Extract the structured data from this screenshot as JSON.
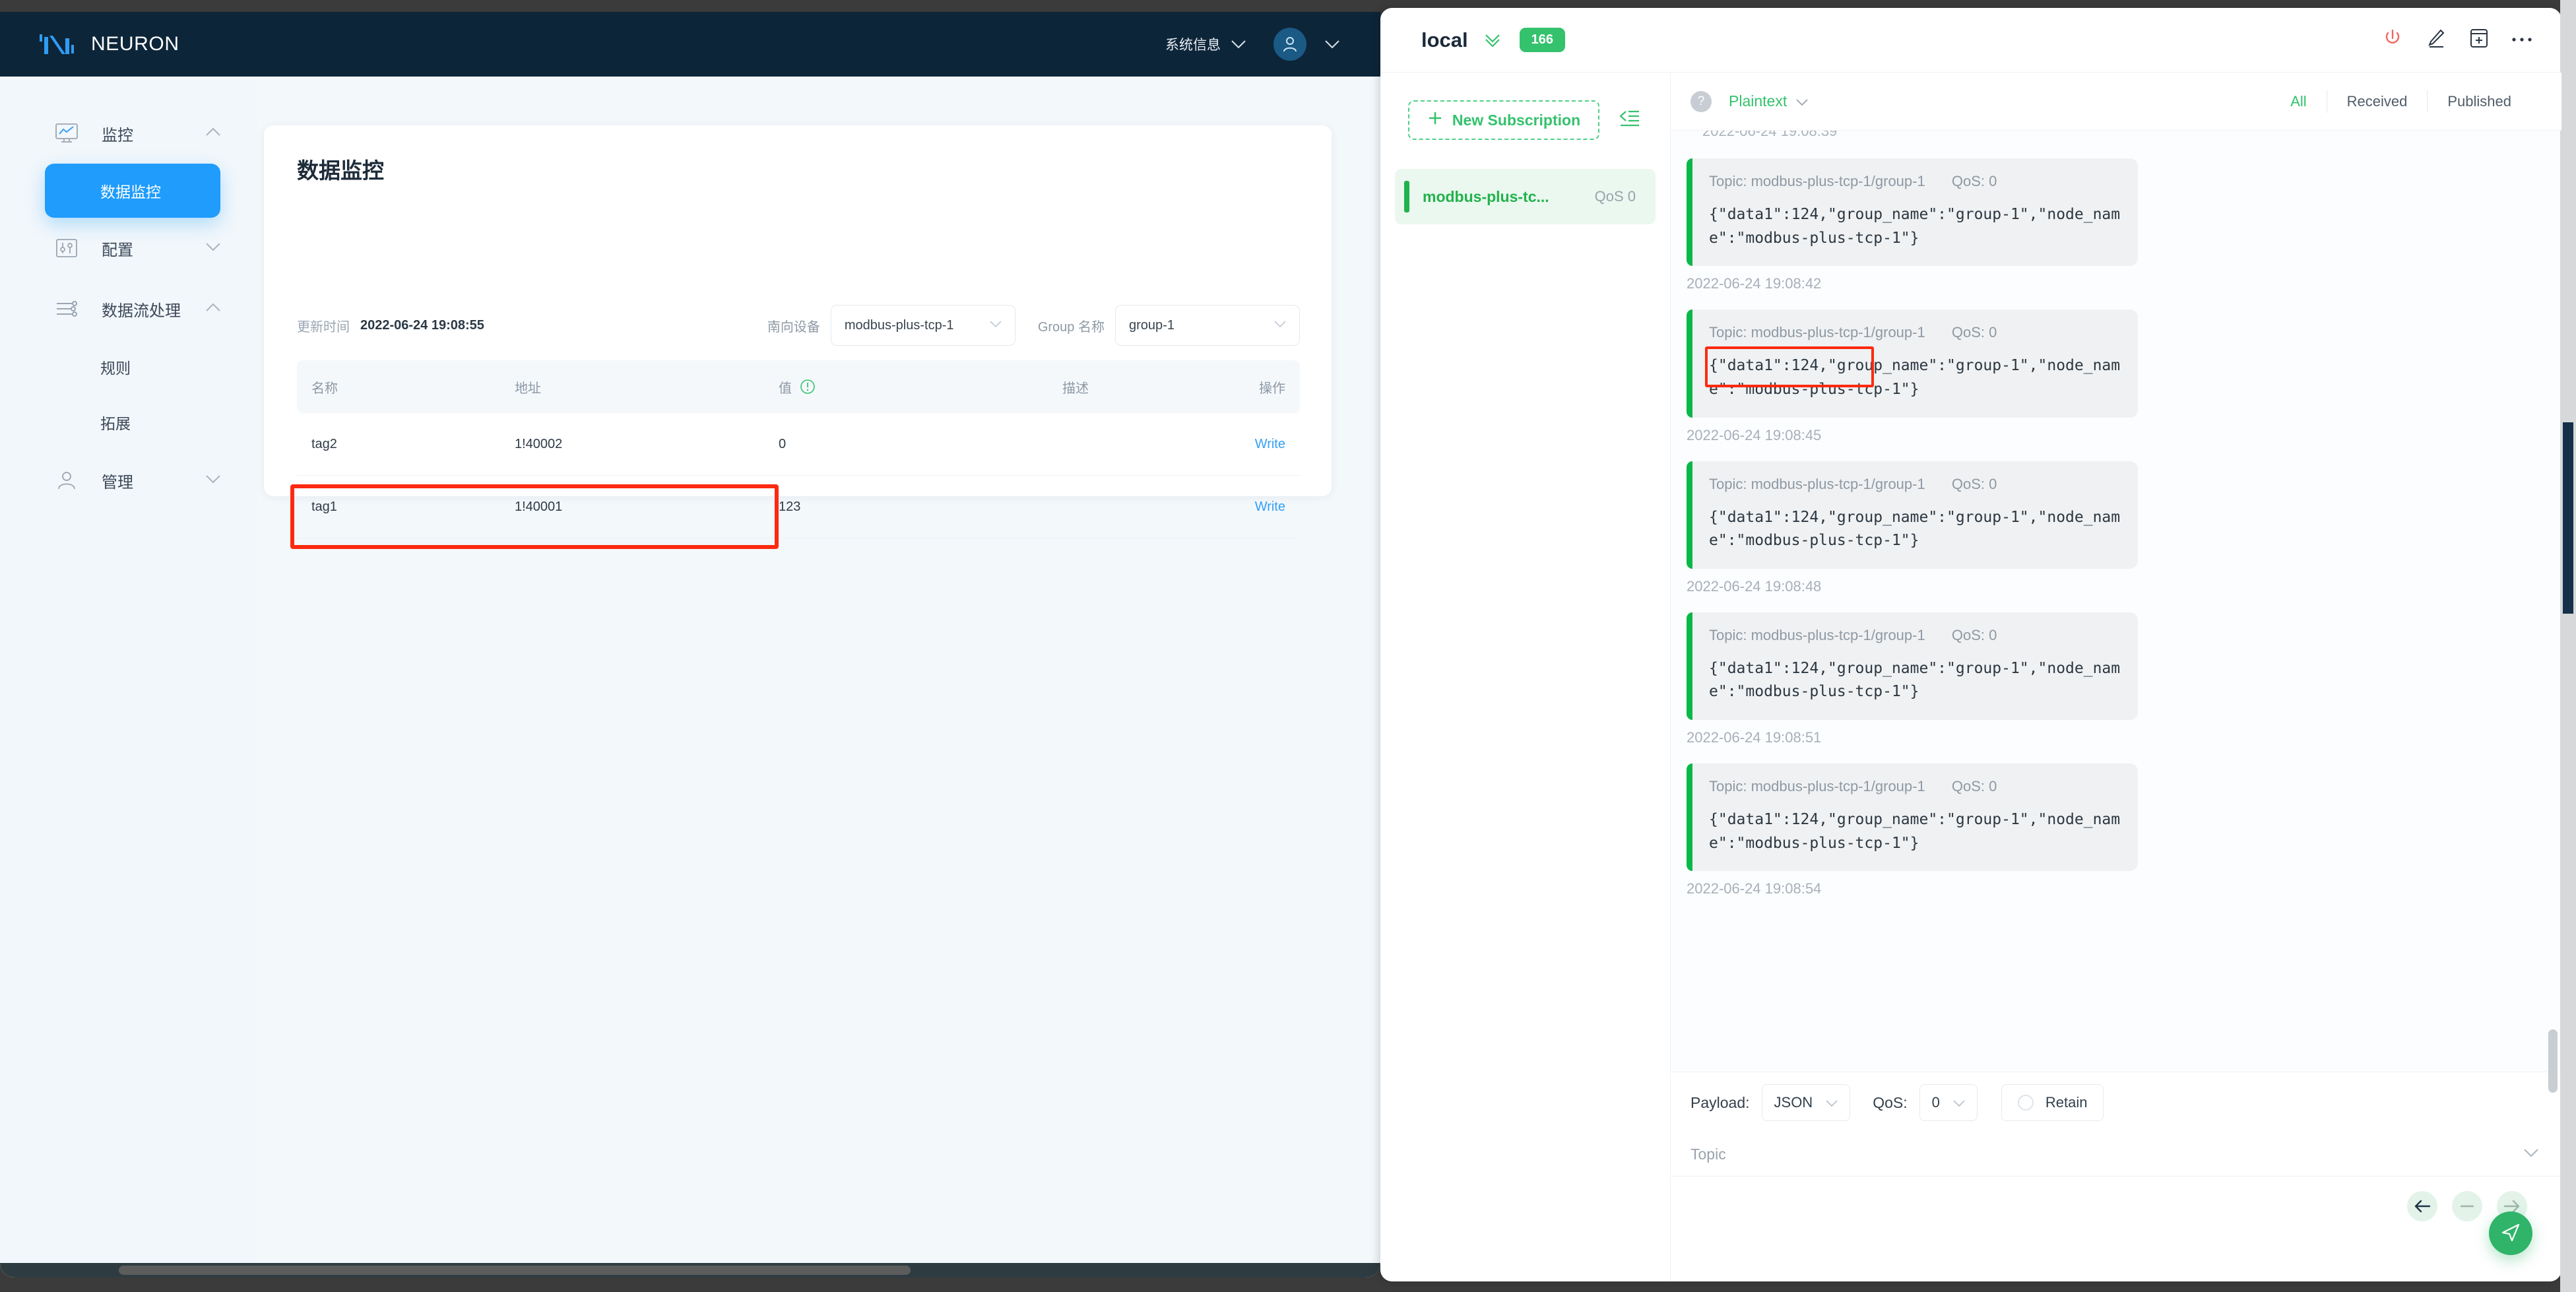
{
  "neuron": {
    "brand": "NEURON",
    "nav": {
      "system_info": "系统信息"
    },
    "sidebar": [
      {
        "label": "监控",
        "icon": "monitor-icon",
        "caret": "chevron-up-icon",
        "type": "group"
      },
      {
        "label": "数据监控",
        "type": "sub",
        "active": true
      },
      {
        "label": "配置",
        "icon": "sliders-icon",
        "caret": "chevron-down-icon",
        "type": "group"
      },
      {
        "label": "数据流处理",
        "icon": "dataflow-icon",
        "caret": "chevron-up-icon",
        "type": "group"
      },
      {
        "label": "规则",
        "type": "sub",
        "active": false
      },
      {
        "label": "拓展",
        "type": "sub",
        "active": false
      },
      {
        "label": "管理",
        "icon": "user-icon",
        "caret": "chevron-down-icon",
        "type": "group"
      }
    ],
    "page": {
      "title": "数据监控",
      "updated_label": "更新时间",
      "updated_value": "2022-06-24 19:08:55",
      "device_label": "南向设备",
      "device_value": "modbus-plus-tcp-1",
      "group_label": "Group 名称",
      "group_value": "group-1"
    },
    "table": {
      "headers": {
        "name": "名称",
        "address": "地址",
        "value": "值",
        "description": "描述",
        "operation": "操作"
      },
      "rows": [
        {
          "name": "tag2",
          "address": "1!40002",
          "value": "0",
          "description": "",
          "action": "Write",
          "highlighted": false
        },
        {
          "name": "tag1",
          "address": "1!40001",
          "value": "123",
          "description": "",
          "action": "Write",
          "highlighted": true
        }
      ]
    }
  },
  "mqttx": {
    "header": {
      "connection_name": "local",
      "message_count": "166"
    },
    "subscriptions": {
      "new_button": "New Subscription",
      "items": [
        {
          "topic": "modbus-plus-tc...",
          "qos": "QoS 0"
        }
      ]
    },
    "toolbar": {
      "format": "Plaintext",
      "filters": [
        {
          "label": "All",
          "active": true
        },
        {
          "label": "Received",
          "active": false
        },
        {
          "label": "Published",
          "active": false
        }
      ]
    },
    "messages": [
      {
        "topic_label": "Topic: modbus-plus-tcp-1/group-1",
        "qos": "QoS: 0",
        "payload": "{\"data1\":124,\"group_name\":\"group-1\",\"node_name\":\"modbus-plus-tcp-1\"}",
        "time": "2022-06-24 19:08:42",
        "annotated": false
      },
      {
        "topic_label": "Topic: modbus-plus-tcp-1/group-1",
        "qos": "QoS: 0",
        "payload": "{\"data1\":124,\"group_name\":\"group-1\",\"node_name\":\"modbus-plus-tcp-1\"}",
        "time": "2022-06-24 19:08:45",
        "annotated": true
      },
      {
        "topic_label": "Topic: modbus-plus-tcp-1/group-1",
        "qos": "QoS: 0",
        "payload": "{\"data1\":124,\"group_name\":\"group-1\",\"node_name\":\"modbus-plus-tcp-1\"}",
        "time": "2022-06-24 19:08:48",
        "annotated": false
      },
      {
        "topic_label": "Topic: modbus-plus-tcp-1/group-1",
        "qos": "QoS: 0",
        "payload": "{\"data1\":124,\"group_name\":\"group-1\",\"node_name\":\"modbus-plus-tcp-1\"}",
        "time": "2022-06-24 19:08:51",
        "annotated": false
      },
      {
        "topic_label": "Topic: modbus-plus-tcp-1/group-1",
        "qos": "QoS: 0",
        "payload": "{\"data1\":124,\"group_name\":\"group-1\",\"node_name\":\"modbus-plus-tcp-1\"}",
        "time": "2022-06-24 19:08:54",
        "annotated": false
      }
    ],
    "publish": {
      "payload_label": "Payload:",
      "payload_value": "JSON",
      "qos_label": "QoS:",
      "qos_value": "0",
      "retain_label": "Retain",
      "topic_placeholder": "Topic"
    }
  },
  "colors": {
    "brand_navy": "#0d2539",
    "accent_blue": "#1f9cfc",
    "mqtt_green": "#34c26d",
    "annotation_red": "#fd2a0e",
    "power_red": "#f4655f"
  }
}
